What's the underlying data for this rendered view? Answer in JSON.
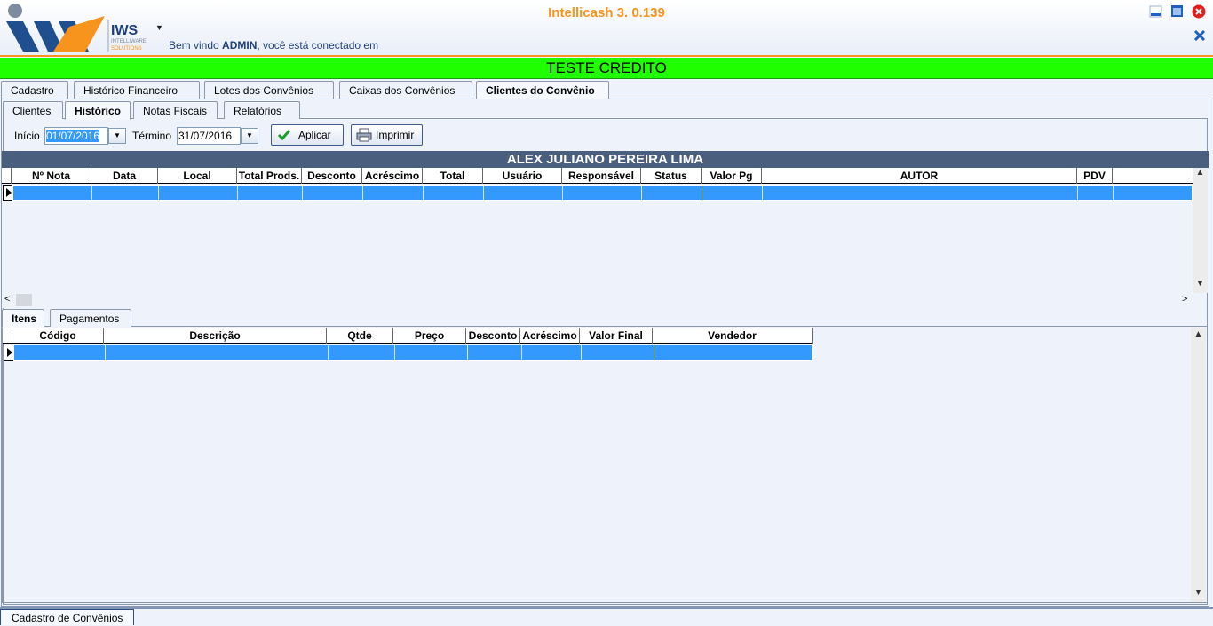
{
  "app": {
    "title": "Intellicash 3. 0.139",
    "logo_text": "IWS",
    "logo_subtext1": "INTELLIWARE",
    "logo_subtext2": "SOLUTIONS",
    "welcome_prefix": "Bem vindo ",
    "welcome_user": "ADMIN",
    "welcome_suffix": ", você está conectado em",
    "company_bar": "TESTE CREDITO",
    "accent_color": "#f7941d",
    "company_bar_color": "#20ff00"
  },
  "main_tabs": [
    {
      "label": "Cadastro"
    },
    {
      "label": "Histórico Financeiro"
    },
    {
      "label": "Lotes dos Convênios"
    },
    {
      "label": "Caixas dos Convênios"
    },
    {
      "label": "Clientes do Convênio"
    }
  ],
  "sub_tabs": [
    {
      "label": "Clientes"
    },
    {
      "label": "Histórico"
    },
    {
      "label": "Notas Fiscais"
    },
    {
      "label": "Relatórios"
    }
  ],
  "filter": {
    "start_label": "Início",
    "start_value": "01/07/2016",
    "end_label": "Término",
    "end_value": "31/07/2016",
    "apply_label": "Aplicar",
    "print_label": "Imprimir"
  },
  "client_name": "ALEX JULIANO PEREIRA LIMA",
  "history_columns": [
    "Nº Nota",
    "Data",
    "Local",
    "Total Prods.",
    "Desconto",
    "Acréscimo",
    "Total",
    "Usuário",
    "Responsável",
    "Status",
    "Valor Pg",
    "AUTOR",
    "PDV"
  ],
  "detail_tabs": [
    {
      "label": "Itens"
    },
    {
      "label": "Pagamentos"
    }
  ],
  "items_columns": [
    "Código",
    "Descrição",
    "Qtde",
    "Preço",
    "Desconto",
    "Acréscimo",
    "Valor Final",
    "Vendedor"
  ],
  "status_tab": "Cadastro de Convênios"
}
